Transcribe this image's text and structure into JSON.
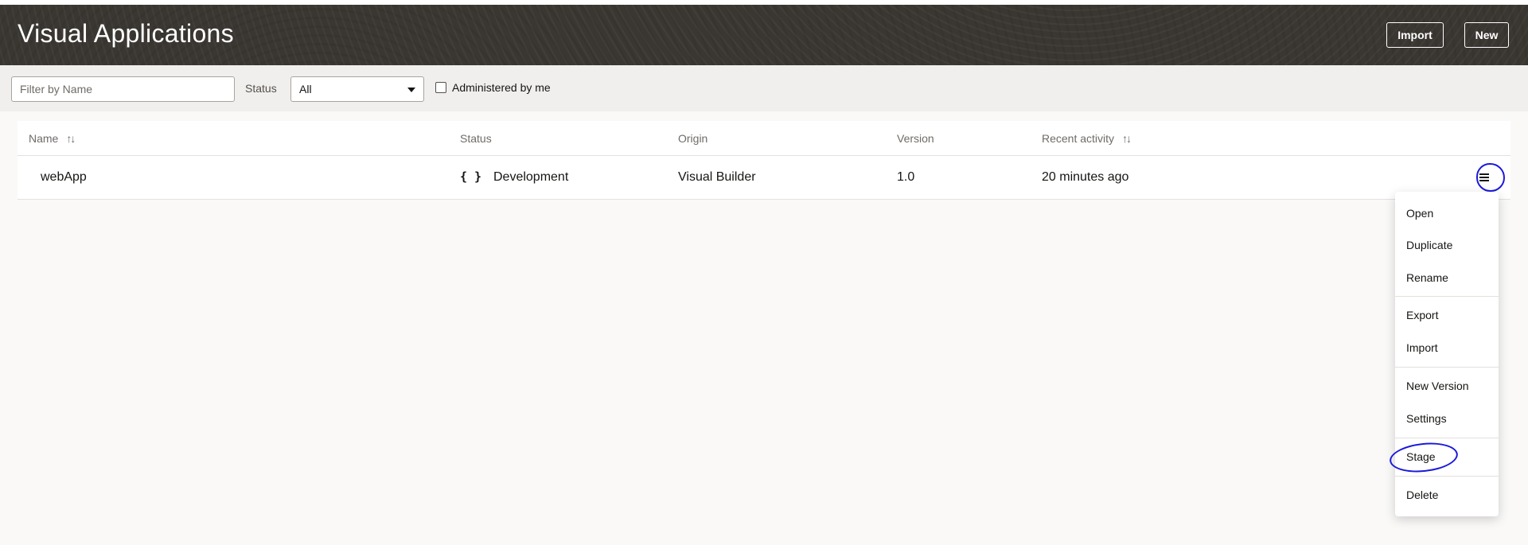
{
  "header": {
    "title": "Visual Applications",
    "import_label": "Import",
    "new_label": "New"
  },
  "toolbar": {
    "filter_placeholder": "Filter by Name",
    "status_label": "Status",
    "status_value": "All",
    "administered_label": "Administered by me"
  },
  "table": {
    "columns": {
      "name": "Name",
      "status": "Status",
      "origin": "Origin",
      "version": "Version",
      "recent_activity": "Recent activity"
    },
    "rows": [
      {
        "name": "webApp",
        "status_icon": "{ }",
        "status": "Development",
        "origin": "Visual Builder",
        "version": "1.0",
        "recent_activity": "20 minutes ago"
      }
    ]
  },
  "row_menu": {
    "items": [
      "Open",
      "Duplicate",
      "Rename",
      "Export",
      "Import",
      "New Version",
      "Settings",
      "Stage",
      "Delete"
    ]
  },
  "annotations": {
    "circle_color": "#1a1adb",
    "circled": [
      "row-menu-button",
      "menu-item-stage"
    ]
  },
  "colors": {
    "header_bg": "#3a3632",
    "toolbar_bg": "#f1efed",
    "page_bg": "#faf9f8"
  }
}
